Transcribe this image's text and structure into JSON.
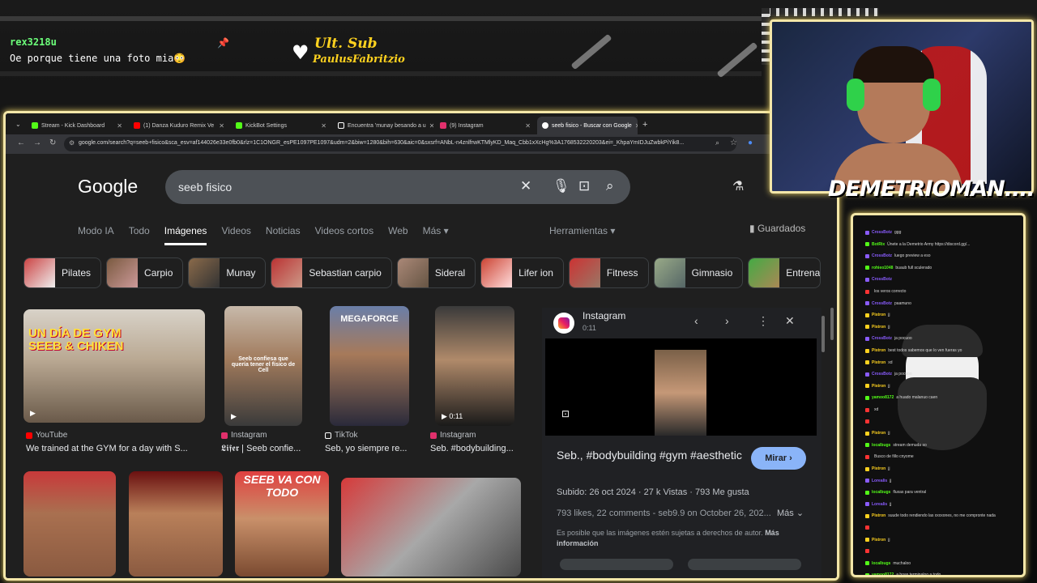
{
  "stream": {
    "chat_user": "rex3218u",
    "chat_message": "Oe porque tiene una foto mia😳",
    "ult_sub_title": "Ult. Sub",
    "ult_sub_name": "PaulusFabritzio",
    "streamer_name": "DEMETRIOMAN....",
    "accent_color": "#f3e6a8"
  },
  "browser": {
    "tabs": [
      {
        "label": "Stream - Kick Dashboard",
        "color": "#53fc18"
      },
      {
        "label": "(1) Danza Kuduro Remix Ve",
        "color": "#ff0000"
      },
      {
        "label": "KickBot Settings",
        "color": "#53fc18"
      },
      {
        "label": "Encuentra 'munay besando a u",
        "color": "#ffffff"
      },
      {
        "label": "(9) Instagram",
        "color": "#e1306c"
      },
      {
        "label": "seeb fisico - Buscar con Google",
        "color": "#ffffff"
      }
    ],
    "url": "google.com/search?q=seeb+fisico&sca_esv=af144026e33e0fb0&rlz=1C1ONGR_esPE1097PE1097&udm=2&biw=1280&bih=630&aic=0&sxsrf=ANbL-n4znlfrwKTMlyKD_Maq_Cbb1xXcHg%3A1768532220203&ei=_KhpaYmIDJuZwbkPiYik8..."
  },
  "google": {
    "logo": "Google",
    "query": "seeb fisico",
    "nav_tabs": [
      "Modo IA",
      "Todo",
      "Imágenes",
      "Videos",
      "Noticias",
      "Videos cortos",
      "Web",
      "Más ▾"
    ],
    "active_tab": "Imágenes",
    "tools": "Herramientas ▾",
    "saved": "Guardados",
    "chips": [
      "Pilates",
      "Carpio",
      "Munay",
      "Sebastian carpio",
      "Sideral",
      "Lifer ion",
      "Fitness",
      "Gimnasio",
      "Entrena"
    ],
    "results": [
      {
        "source": "YouTube",
        "caption": "We trained at the GYM for a day with S...",
        "overlay": "UN DÍA DE GYM SEEB & CHIKEN"
      },
      {
        "source": "Instagram",
        "caption": "𝕷𝖎𝖋𝖊𝖗 | Seeb confie...",
        "overlay": "Seeb confiesa que quería tener el físico de Cell"
      },
      {
        "source": "TikTok",
        "caption": "Seb, yo siempre re...",
        "overlay": "MEGAFORCE"
      },
      {
        "source": "Instagram",
        "caption": "Seb. #bodybuilding...",
        "overlay": "0:11"
      }
    ],
    "row2_overlay": "SEEB VA CON TODO"
  },
  "panel": {
    "source": "Instagram",
    "time": "0:11",
    "title": "Seb., #bodybuilding #gym #aesthetic",
    "button": "Mirar ›",
    "meta": "Subido: 26 oct 2024 · 27 k Vistas · 793 Me gusta",
    "desc": "793 likes, 22 comments - seb9.9 on October 26, 202...",
    "more": "Más ⌄",
    "note": "Es posible que las imágenes estén sujetas a derechos de autor.",
    "note_more": "Más información"
  },
  "right_chat": [
    {
      "name": "CrossBotz",
      "msg": "ggg",
      "c": "#8a5cff"
    },
    {
      "name": "BotRix",
      "msg": "Únete a la Demetrio Army https://discord.gg/...",
      "c": "#53fc18"
    },
    {
      "name": "CrossBotz",
      "msg": "luego preview a eso",
      "c": "#8a5cff"
    },
    {
      "name": "rohieo1048",
      "msg": "buaub full sculerado",
      "c": "#53fc18"
    },
    {
      "name": "CrossBotz",
      "msg": "",
      "c": "#8a5cff"
    },
    {
      "name": "",
      "msg": "los veros correcto",
      "c": "#ff3333"
    },
    {
      "name": "CrossBotz",
      "msg": "paamuno",
      "c": "#8a5cff"
    },
    {
      "name": "Pistron",
      "msg": "jj",
      "c": "#ffd21f"
    },
    {
      "name": "Pistron",
      "msg": "jj",
      "c": "#ffd21f"
    },
    {
      "name": "CrossBotz",
      "msg": "ja pocuoo",
      "c": "#8a5cff"
    },
    {
      "name": "Pistron",
      "msg": "best todos sabemos que lo ven fueras yo",
      "c": "#ffd21f"
    },
    {
      "name": "Pistron",
      "msg": "xd",
      "c": "#ffd21f"
    },
    {
      "name": "CrossBotz",
      "msg": "ja pocuoo",
      "c": "#8a5cff"
    },
    {
      "name": "Pistron",
      "msg": "jj",
      "c": "#ffd21f"
    },
    {
      "name": "yamoo8172",
      "msg": "a huado malanuo caen",
      "c": "#53fc18"
    },
    {
      "name": "",
      "msg": "xd",
      "c": "#ff3333"
    },
    {
      "name": "",
      "msg": "",
      "c": "#ff3333"
    },
    {
      "name": "Pistron",
      "msg": "jj",
      "c": "#ffd21f"
    },
    {
      "name": "localbugs",
      "msg": "stream demuda so",
      "c": "#53fc18"
    },
    {
      "name": "",
      "msg": "Busco de fillo cnyome",
      "c": "#ff3333"
    },
    {
      "name": "Pistron",
      "msg": "jj",
      "c": "#ffd21f"
    },
    {
      "name": "Lorealis",
      "msg": "jj",
      "c": "#8a5cff"
    },
    {
      "name": "localbugs",
      "msg": "fluxas para ventral",
      "c": "#53fc18"
    },
    {
      "name": "Lorealis",
      "msg": "jj",
      "c": "#8a5cff"
    },
    {
      "name": "Pistron",
      "msg": "suude todo rendiendo las xxxxones, no me compronte nada",
      "c": "#ffd21f"
    },
    {
      "name": "",
      "msg": "",
      "c": "#ff3333"
    },
    {
      "name": "Pistron",
      "msg": "jj",
      "c": "#ffd21f"
    },
    {
      "name": "",
      "msg": "",
      "c": "#ff3333"
    },
    {
      "name": "localbugs",
      "msg": "muchaloo",
      "c": "#53fc18"
    },
    {
      "name": "yamoo8172",
      "msg": "a hoas terminaloo a todo",
      "c": "#53fc18"
    }
  ]
}
